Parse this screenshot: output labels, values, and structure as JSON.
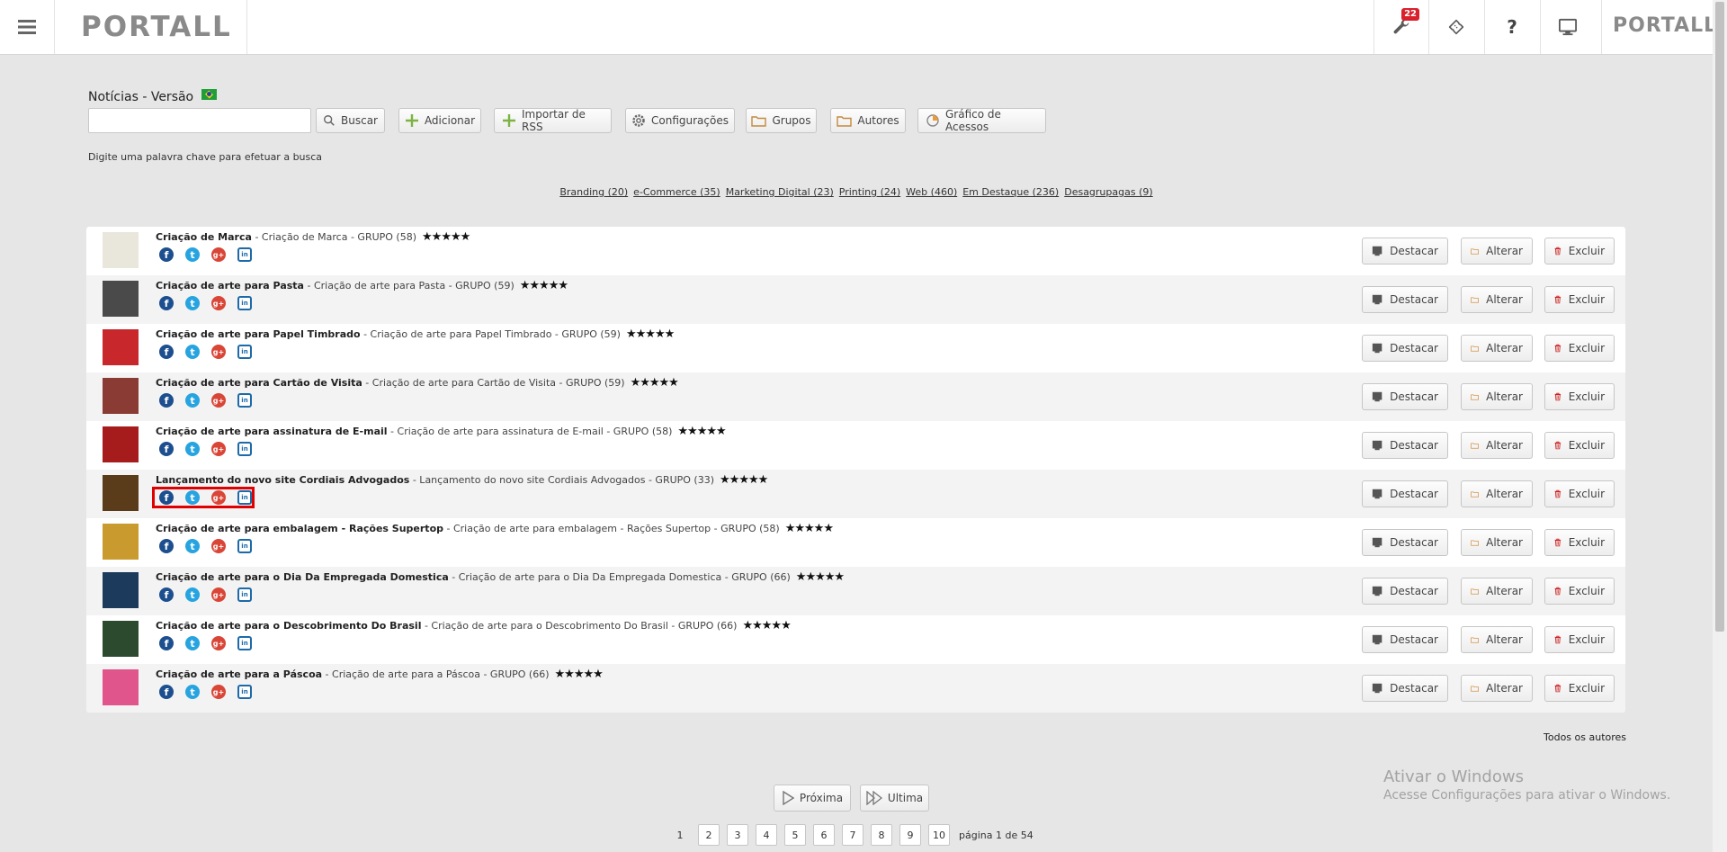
{
  "app": {
    "brand": "PORTALL",
    "brand_right": "PORTALL",
    "notifications_badge": "22"
  },
  "toolbar_icons": [
    "wrench-icon",
    "ticket-icon",
    "help-icon",
    "monitor-icon"
  ],
  "header": {
    "title": "Notícias - Versão",
    "search_placeholder": "",
    "hint": "Digite uma palavra chave para efetuar a busca",
    "buttons": {
      "search": "Buscar",
      "add": "Adicionar",
      "import_rss": "Importar de RSS",
      "settings": "Configurações",
      "groups": "Grupos",
      "authors": "Autores",
      "access_chart": "Gráfico de Acessos"
    }
  },
  "categories": [
    "Branding (20)",
    "e-Commerce (35)",
    "Marketing Digital (23)",
    "Printing (24)",
    "Web (460)",
    "Em Destaque (236)",
    "Desagrupagas (9)"
  ],
  "row_actions": {
    "highlight": "Destacar",
    "edit": "Alterar",
    "delete": "Excluir"
  },
  "rows": [
    {
      "title": "Criação de Marca",
      "subtitle": "- Criação de Marca - GRUPO (58)",
      "stars": "★★★★★",
      "thumb": "#e9e6dc"
    },
    {
      "title": "Criação de arte para Pasta",
      "subtitle": "- Criação de arte para Pasta - GRUPO (59)",
      "stars": "★★★★★",
      "thumb": "#4a4a4a"
    },
    {
      "title": "Criação de arte para Papel Timbrado",
      "subtitle": "- Criação de arte para Papel Timbrado - GRUPO (59)",
      "stars": "★★★★★",
      "thumb": "#c8282c"
    },
    {
      "title": "Criação de arte para Cartão de Visita",
      "subtitle": "- Criação de arte para Cartão de Visita - GRUPO (59)",
      "stars": "★★★★★",
      "thumb": "#8a3c34"
    },
    {
      "title": "Criação de arte para assinatura de E-mail",
      "subtitle": "- Criação de arte para assinatura de E-mail - GRUPO (58)",
      "stars": "★★★★★",
      "thumb": "#a61c1c"
    },
    {
      "title": "Lançamento do novo site Cordiais Advogados",
      "subtitle": "- Lançamento do novo site Cordiais Advogados - GRUPO (33)",
      "stars": "★★★★★",
      "thumb": "#5a3b1a"
    },
    {
      "title": "Criação de arte para embalagem - Rações Supertop",
      "subtitle": "- Criação de arte para embalagem - Rações Supertop - GRUPO (58)",
      "stars": "★★★★★",
      "thumb": "#c99a2e"
    },
    {
      "title": "Criação de arte para o Dia Da Empregada Domestica",
      "subtitle": "- Criação de arte para o Dia Da Empregada Domestica - GRUPO (66)",
      "stars": "★★★★★",
      "thumb": "#1b3a5c"
    },
    {
      "title": "Criação de arte para o Descobrimento Do Brasil",
      "subtitle": "- Criação de arte para o Descobrimento Do Brasil - GRUPO (66)",
      "stars": "★★★★★",
      "thumb": "#2c4a2e"
    },
    {
      "title": "Criação de arte para a Páscoa",
      "subtitle": "- Criação de arte para a Páscoa - GRUPO (66)",
      "stars": "★★★★★",
      "thumb": "#e0568c"
    }
  ],
  "social": {
    "fb": "f",
    "tw": "t",
    "gp": "g+",
    "li": "in"
  },
  "footer": {
    "all_authors": "Todos os autores",
    "next": "Próxima",
    "last": "Ultima",
    "pages": [
      "1",
      "2",
      "3",
      "4",
      "5",
      "6",
      "7",
      "8",
      "9",
      "10"
    ],
    "current_page": "1",
    "page_info": "página 1 de 54"
  },
  "watermark": {
    "line1": "Ativar o Windows",
    "line2": "Acesse Configurações para ativar o Windows."
  },
  "highlighted_row_index": 5
}
